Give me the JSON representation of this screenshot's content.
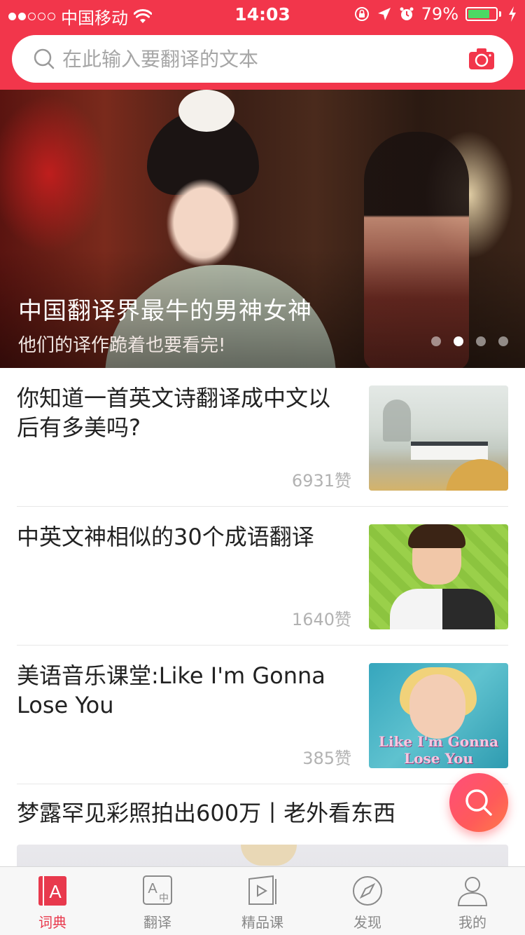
{
  "status_bar": {
    "carrier": "中国移动",
    "time": "14:03",
    "battery_percent": "79%",
    "battery_level": 0.79,
    "signal_bars_filled": 2,
    "signal_bars_total": 5
  },
  "search": {
    "placeholder": "在此输入要翻译的文本",
    "icon": "search-icon",
    "camera_icon": "camera-icon"
  },
  "banner": {
    "title": "中国翻译界最牛的男神女神",
    "subtitle": "他们的译作跪着也要看完!",
    "page_count": 4,
    "active_page": 2
  },
  "articles": [
    {
      "title": "你知道一首英文诗翻译成中文以后有多美吗?",
      "likes": "6931赞"
    },
    {
      "title": "中英文神相似的30个成语翻译",
      "likes": "1640赞"
    },
    {
      "title": "美语音乐课堂:Like I'm Gonna Lose You",
      "likes": "385赞",
      "thumb_text": "Like I'm Gonna Lose You"
    },
    {
      "title": "梦露罕见彩照拍出600万丨老外看东西"
    }
  ],
  "tabs": [
    {
      "label": "词典",
      "icon": "dictionary-icon",
      "active": true
    },
    {
      "label": "翻译",
      "icon": "translate-icon",
      "active": false
    },
    {
      "label": "精品课",
      "icon": "course-icon",
      "active": false
    },
    {
      "label": "发现",
      "icon": "compass-icon",
      "active": false
    },
    {
      "label": "我的",
      "icon": "user-icon",
      "active": false
    }
  ],
  "colors": {
    "brand": "#f2364b",
    "tab_active": "#e8394d",
    "battery_green": "#4cd964"
  }
}
